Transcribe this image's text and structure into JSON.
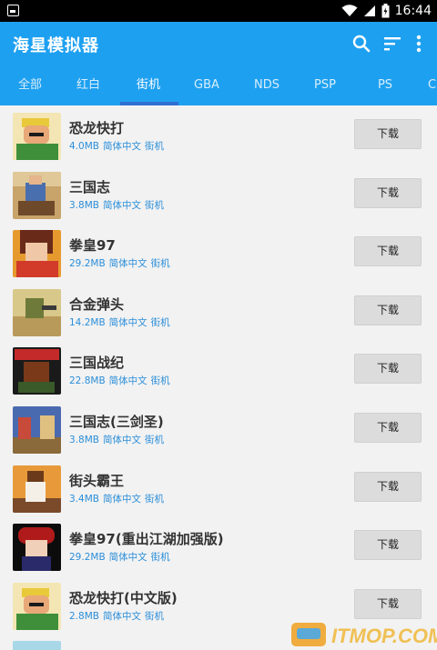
{
  "status_bar": {
    "time": "16:44"
  },
  "app_bar": {
    "title": "海星模拟器",
    "actions": [
      "search-icon",
      "sort-icon",
      "more-vert-icon"
    ]
  },
  "tabs": [
    {
      "label": "全部"
    },
    {
      "label": "红白"
    },
    {
      "label": "街机",
      "active": true
    },
    {
      "label": "GBA"
    },
    {
      "label": "NDS"
    },
    {
      "label": "PSP"
    },
    {
      "label": "PS"
    },
    {
      "label": "C"
    }
  ],
  "games": [
    {
      "name": "恐龙快打",
      "size": "4.0MB",
      "language": "简体中文",
      "category": "街机",
      "button": "下载"
    },
    {
      "name": "三国志",
      "size": "3.8MB",
      "language": "简体中文",
      "category": "街机",
      "button": "下载"
    },
    {
      "name": "拳皇97",
      "size": "29.2MB",
      "language": "简体中文",
      "category": "街机",
      "button": "下载"
    },
    {
      "name": "合金弹头",
      "size": "14.2MB",
      "language": "简体中文",
      "category": "街机",
      "button": "下载"
    },
    {
      "name": "三国战纪",
      "size": "22.8MB",
      "language": "简体中文",
      "category": "街机",
      "button": "下载"
    },
    {
      "name": "三国志(三剑圣)",
      "size": "3.8MB",
      "language": "简体中文",
      "category": "街机",
      "button": "下载"
    },
    {
      "name": "街头霸王",
      "size": "3.4MB",
      "language": "简体中文",
      "category": "街机",
      "button": "下载"
    },
    {
      "name": "拳皇97(重出江湖加强版)",
      "size": "29.2MB",
      "language": "简体中文",
      "category": "街机",
      "button": "下载"
    },
    {
      "name": "恐龙快打(中文版)",
      "size": "2.8MB",
      "language": "简体中文",
      "category": "街机",
      "button": "下载"
    }
  ],
  "colors": {
    "primary": "#1ea0f0",
    "indicator": "#2f6fd1",
    "meta_text": "#2b8ed9",
    "button_bg": "#dcdcdc"
  },
  "watermark": {
    "text": "ITMOP.COM"
  }
}
